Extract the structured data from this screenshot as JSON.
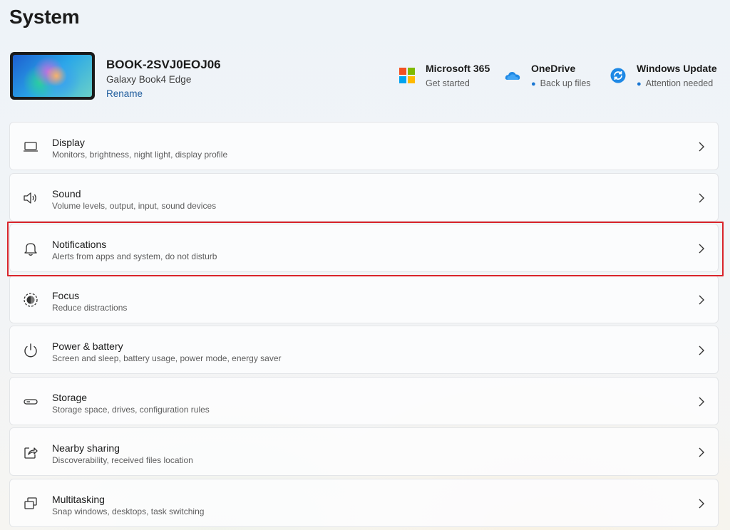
{
  "page": {
    "title": "System"
  },
  "device": {
    "name": "BOOK-2SVJ0EOJ06",
    "model": "Galaxy Book4 Edge",
    "rename_label": "Rename"
  },
  "quick_links": [
    {
      "title": "Microsoft 365",
      "subtitle": "Get started",
      "icon": "microsoft-365-logo-icon"
    },
    {
      "title": "OneDrive",
      "subtitle": "Back up files",
      "icon": "onedrive-cloud-icon"
    },
    {
      "title": "Windows Update",
      "subtitle": "Attention needed",
      "icon": "windows-update-sync-icon"
    }
  ],
  "settings": [
    {
      "title": "Display",
      "subtitle": "Monitors, brightness, night light, display profile",
      "icon": "monitor-icon"
    },
    {
      "title": "Sound",
      "subtitle": "Volume levels, output, input, sound devices",
      "icon": "speaker-icon"
    },
    {
      "title": "Notifications",
      "subtitle": "Alerts from apps and system, do not disturb",
      "icon": "bell-icon"
    },
    {
      "title": "Focus",
      "subtitle": "Reduce distractions",
      "icon": "focus-icon"
    },
    {
      "title": "Power & battery",
      "subtitle": "Screen and sleep, battery usage, power mode, energy saver",
      "icon": "power-icon"
    },
    {
      "title": "Storage",
      "subtitle": "Storage space, drives, configuration rules",
      "icon": "drive-icon"
    },
    {
      "title": "Nearby sharing",
      "subtitle": "Discoverability, received files location",
      "icon": "share-icon"
    },
    {
      "title": "Multitasking",
      "subtitle": "Snap windows, desktops, task switching",
      "icon": "multitasking-windows-icon"
    }
  ],
  "colors": {
    "link": "#205e9e",
    "status_dot": "#1976d2",
    "highlight": "#d9242b"
  }
}
